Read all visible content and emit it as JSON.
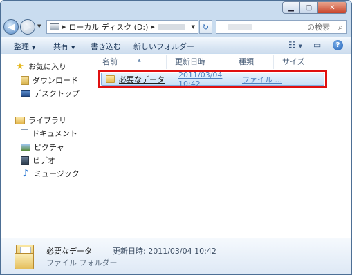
{
  "address": {
    "path_segments": [
      "ローカル ディスク (D:)"
    ]
  },
  "search": {
    "placeholder_suffix": "の検索"
  },
  "toolbar": {
    "organize": "整理",
    "share": "共有",
    "burn": "書き込む",
    "new_folder": "新しいフォルダー"
  },
  "nav": {
    "favorites": "お気に入り",
    "downloads": "ダウンロード",
    "desktop": "デスクトップ",
    "libraries": "ライブラリ",
    "documents": "ドキュメント",
    "pictures": "ピクチャ",
    "videos": "ビデオ",
    "music": "ミュージック"
  },
  "columns": {
    "name": "名前",
    "modified": "更新日時",
    "type": "種類",
    "size": "サイズ"
  },
  "files": [
    {
      "name": "必要なデータ",
      "modified": "2011/03/04 10:42",
      "type": "ファイル ..."
    }
  ],
  "details": {
    "name": "必要なデータ",
    "modified_label": "更新日時:",
    "modified_value": "2011/03/04 10:42",
    "type": "ファイル フォルダー"
  },
  "colors": {
    "highlight_outline": "#e01010",
    "selection": "#c7e0f7",
    "window_frame": "#c9dcef"
  }
}
